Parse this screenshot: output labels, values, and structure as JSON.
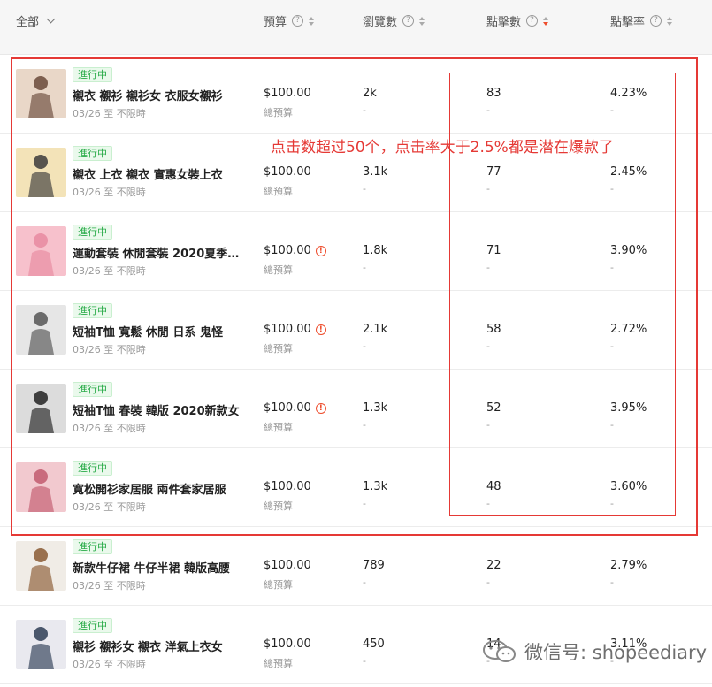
{
  "header": {
    "filter_label": "全部",
    "col_budget": "預算",
    "col_views": "瀏覽數",
    "col_clicks": "點擊數",
    "col_ctr": "點擊率"
  },
  "rows": [
    {
      "status": "進行中",
      "name": "襯衣 襯衫 襯衫女 衣服女襯衫",
      "date": "03/26 至 不限時",
      "budget": "$100.00",
      "budget_label": "總預算",
      "views": "2k",
      "views_sub": "-",
      "clicks": "83",
      "clicks_sub": "-",
      "ctr": "4.23%",
      "ctr_sub": "-",
      "warn": false
    },
    {
      "status": "進行中",
      "name": "襯衣 上衣 襯衣 實惠女裝上衣",
      "date": "03/26 至 不限時",
      "budget": "$100.00",
      "budget_label": "總預算",
      "views": "3.1k",
      "views_sub": "-",
      "clicks": "77",
      "clicks_sub": "-",
      "ctr": "2.45%",
      "ctr_sub": "-",
      "warn": false
    },
    {
      "status": "進行中",
      "name": "運動套裝 休閒套裝 2020夏季新款",
      "date": "03/26 至 不限時",
      "budget": "$100.00",
      "budget_label": "總預算",
      "views": "1.8k",
      "views_sub": "-",
      "clicks": "71",
      "clicks_sub": "-",
      "ctr": "3.90%",
      "ctr_sub": "-",
      "warn": true
    },
    {
      "status": "進行中",
      "name": "短袖T恤 寬鬆 休閒 日系 鬼怪",
      "date": "03/26 至 不限時",
      "budget": "$100.00",
      "budget_label": "總預算",
      "views": "2.1k",
      "views_sub": "-",
      "clicks": "58",
      "clicks_sub": "-",
      "ctr": "2.72%",
      "ctr_sub": "-",
      "warn": true
    },
    {
      "status": "進行中",
      "name": "短袖T恤 春裝 韓版 2020新款女",
      "date": "03/26 至 不限時",
      "budget": "$100.00",
      "budget_label": "總預算",
      "views": "1.3k",
      "views_sub": "-",
      "clicks": "52",
      "clicks_sub": "-",
      "ctr": "3.95%",
      "ctr_sub": "-",
      "warn": true
    },
    {
      "status": "進行中",
      "name": "寬松開衫家居服 兩件套家居服",
      "date": "03/26 至 不限時",
      "budget": "$100.00",
      "budget_label": "總預算",
      "views": "1.3k",
      "views_sub": "-",
      "clicks": "48",
      "clicks_sub": "-",
      "ctr": "3.60%",
      "ctr_sub": "-",
      "warn": false
    },
    {
      "status": "進行中",
      "name": "新款牛仔裙 牛仔半裙 韓版高腰",
      "date": "03/26 至 不限時",
      "budget": "$100.00",
      "budget_label": "總預算",
      "views": "789",
      "views_sub": "-",
      "clicks": "22",
      "clicks_sub": "-",
      "ctr": "2.79%",
      "ctr_sub": "-",
      "warn": false
    },
    {
      "status": "進行中",
      "name": "襯衫 襯衫女 襯衣 洋氣上衣女",
      "date": "03/26 至 不限時",
      "budget": "$100.00",
      "budget_label": "總預算",
      "views": "450",
      "views_sub": "-",
      "clicks": "14",
      "clicks_sub": "-",
      "ctr": "3.11%",
      "ctr_sub": "-",
      "warn": false
    }
  ],
  "annotation": "点击数超过50个，点击率大于2.5%都是潜在爆款了",
  "watermark": "微信号: shopeediary",
  "colors": {
    "accent": "#ee4d2d",
    "status_green": "#26aa46",
    "annotation_red": "#e53935"
  }
}
